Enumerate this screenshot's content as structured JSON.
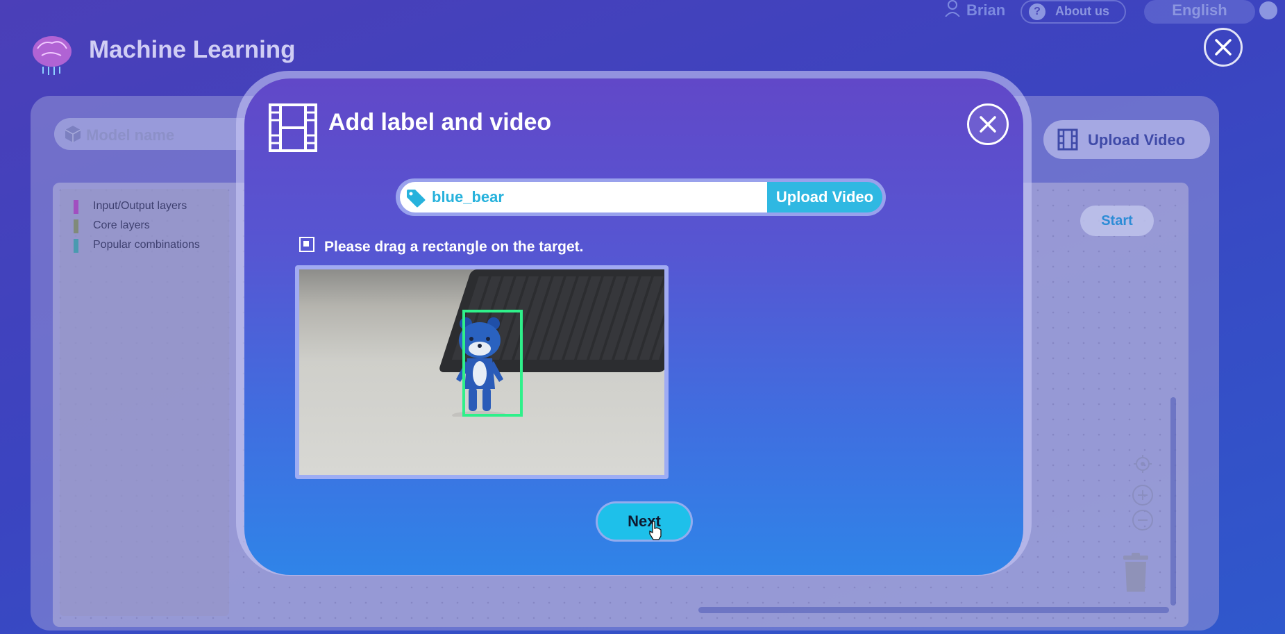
{
  "app": {
    "title": "Machine Learning",
    "user_name": "Brian",
    "about_label": "About us",
    "language": "English"
  },
  "workspace": {
    "model_name_placeholder": "Model name",
    "upload_video_label": "Upload Video",
    "start_label": "Start",
    "legend": [
      {
        "label": "Input/Output layers",
        "color": "#a14fc0"
      },
      {
        "label": "Core layers",
        "color": "#808a7a"
      },
      {
        "label": "Popular combinations",
        "color": "#4a9ab0"
      }
    ]
  },
  "modal": {
    "title": "Add label and video",
    "label_value": "blue_bear",
    "upload_video_label": "Upload Video",
    "instruction": "Please drag a rectangle on the target.",
    "next_label": "Next",
    "bbox_color": "#2ff08a"
  },
  "icons": [
    "brain-logo-icon",
    "user-icon",
    "help-icon",
    "globe-icon",
    "close-icon",
    "cube-icon",
    "film-icon",
    "tag-icon",
    "checkbox-icon",
    "locate-icon",
    "zoom-in-icon",
    "zoom-out-icon",
    "trash-icon",
    "pointer-cursor-icon"
  ]
}
